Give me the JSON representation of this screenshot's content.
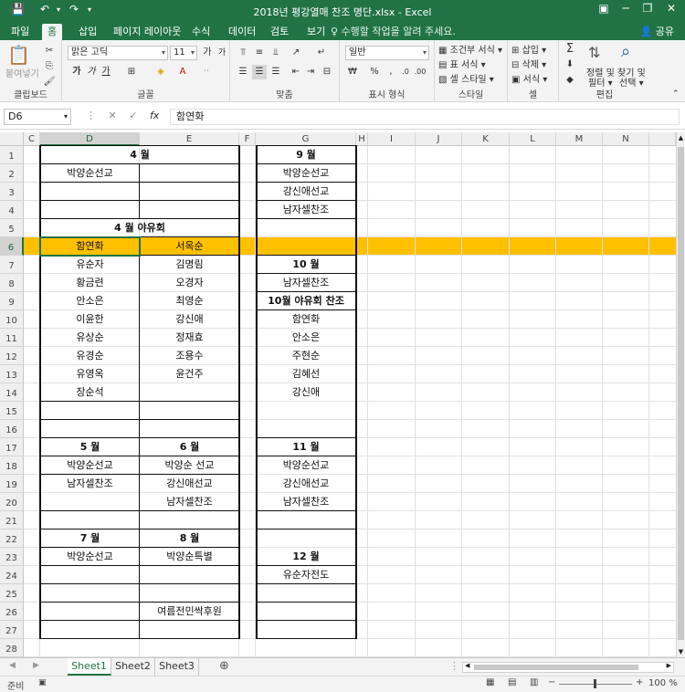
{
  "window": {
    "title": "2018년 평강열매 찬조 명단.xlsx - Excel",
    "minimize": "─",
    "restore": "❐",
    "close": "✕",
    "ribbon_display": "▣"
  },
  "tabs": [
    "파일",
    "홈",
    "삽입",
    "페이지 레이아웃",
    "수식",
    "데이터",
    "검토",
    "보기"
  ],
  "active_tab": "홈",
  "tell_me": "♀ 수행할 작업을 알려 주세요.",
  "share": "공유",
  "ribbon": {
    "clipboard": {
      "paste": "붙여넣기",
      "label": "클립보드"
    },
    "font": {
      "name": "맑은 고딕",
      "size": "11",
      "bold": "가",
      "italic": "가",
      "underline": "가",
      "grow": "가",
      "shrink": "가",
      "label": "글꼴"
    },
    "alignment": {
      "label": "맞춤"
    },
    "number": {
      "format": "일반",
      "label": "표시 형식"
    },
    "styles": {
      "conditional": "조건부 서식 ▾",
      "table": "표 서식 ▾",
      "cell": "셀 스타일 ▾",
      "label": "스타일"
    },
    "cells": {
      "insert": "삽입 ▾",
      "delete": "삭제 ▾",
      "format": "서식 ▾",
      "label": "셀"
    },
    "editing": {
      "sort": "정렬 및",
      "sort2": "필터 ▾",
      "find": "찾기 및",
      "find2": "선택 ▾",
      "label": "편집"
    }
  },
  "formula_bar": {
    "name_box": "D6",
    "fx": "fx",
    "value": "함연화"
  },
  "columns": [
    "C",
    "D",
    "E",
    "F",
    "G",
    "H",
    "I",
    "J",
    "K",
    "L",
    "M",
    "N"
  ],
  "rows": [
    "1",
    "2",
    "3",
    "4",
    "5",
    "6",
    "7",
    "8",
    "9",
    "10",
    "11",
    "12",
    "13",
    "14",
    "15",
    "16",
    "17",
    "18",
    "19",
    "20",
    "21",
    "22",
    "23",
    "24",
    "25",
    "26",
    "27",
    "28"
  ],
  "cells": {
    "D1": "4 월",
    "D2": "박양순선교",
    "D5": "4 월 야유회",
    "D6": "함연화",
    "E6": "서옥순",
    "D7": "유순자",
    "E7": "김명림",
    "D8": "황금련",
    "E8": "오경자",
    "D9": "안소은",
    "E9": "최영순",
    "D10": "이윤한",
    "E10": "강신애",
    "D11": "유상순",
    "E11": "정재효",
    "D12": "유경순",
    "E12": "조용수",
    "D13": "유영옥",
    "E13": "윤건주",
    "D14": "장순석",
    "D17": "5 월",
    "E17": "6 월",
    "D18": "박양순선교",
    "E18": "박양순 선교",
    "D19": "남자셀찬조",
    "E19": "강신애선교",
    "E20": "남자셀찬조",
    "D22": "7 월",
    "E22": "8 월",
    "D23": "박양순선교",
    "E23": "박양순특별",
    "E26": "여름전민싹후원",
    "G1": "9  월",
    "G2": "박양순선교",
    "G3": "강신애선교",
    "G4": "남자셀찬조",
    "G7": "10 월",
    "G8": "남자셀찬조",
    "G9": "10월 야유회 찬조",
    "G10": "함연화",
    "G11": "안소은",
    "G12": "주현순",
    "G13": "김혜선",
    "G14": "강신애",
    "G17": "11  월",
    "G18": "박양순선교",
    "G19": "강신애선교",
    "G20": "남자셀찬조",
    "G23": "12 월",
    "G24": "유순자전도"
  },
  "highlight_color": "#ffc000",
  "accent_color": "#217346",
  "sheets": [
    "Sheet1",
    "Sheet2",
    "Sheet3"
  ],
  "active_sheet": "Sheet1",
  "add_sheet": "⊕",
  "status": {
    "ready": "준비",
    "zoom": "100 %",
    "zoom_minus": "−",
    "zoom_plus": "+"
  }
}
